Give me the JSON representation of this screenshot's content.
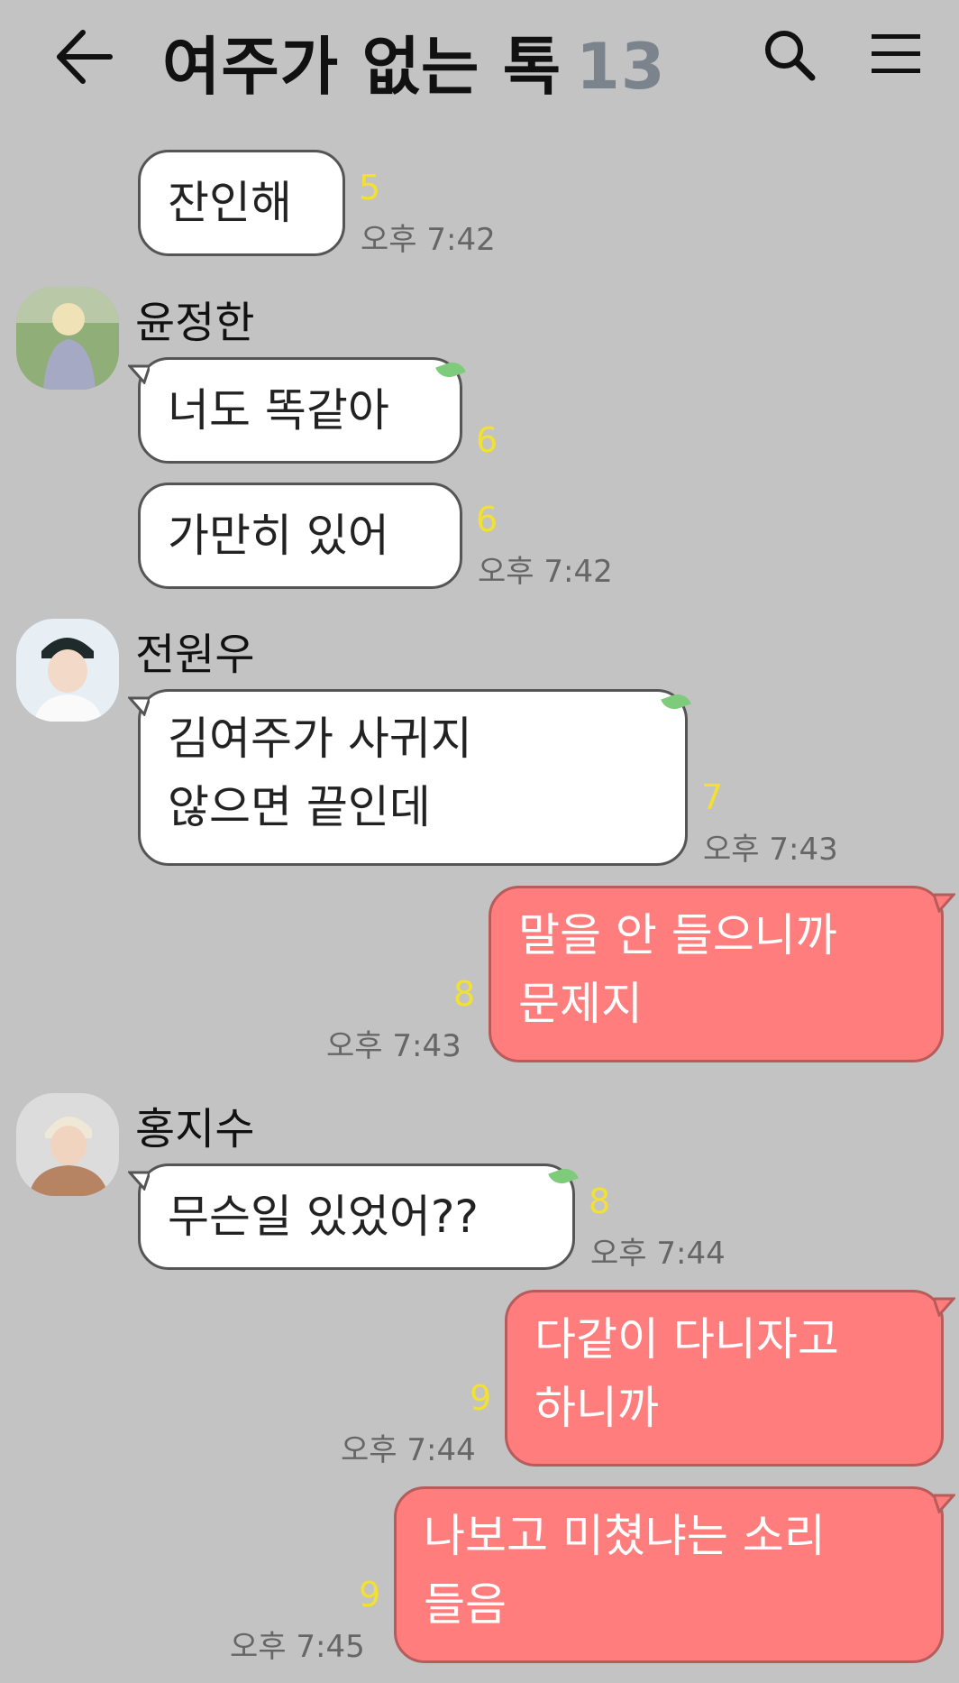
{
  "header": {
    "title": "여주가 없는 톡",
    "member_count": "13",
    "back_icon": "arrow-left-icon",
    "search_icon": "search-icon",
    "menu_icon": "hamburger-menu-icon"
  },
  "colors": {
    "background": "#c3c3c3",
    "my_bubble": "#ff7d7d",
    "other_bubble": "#ffffff",
    "unread": "#f2e131"
  },
  "messages": [
    {
      "sender": "",
      "text": "잔인해",
      "unread": "5",
      "time": "오후 7:42"
    },
    {
      "sender": "윤정한",
      "text": "너도 똑같아",
      "unread": "6",
      "time": ""
    },
    {
      "sender": "",
      "text": "가만히 있어",
      "unread": "6",
      "time": "오후 7:42"
    },
    {
      "sender": "전원우",
      "line1": "김여주가 사귀지",
      "line2": "않으면 끝인데",
      "unread": "7",
      "time": "오후 7:43"
    },
    {
      "sender": "me",
      "line1": "말을 안 들으니까",
      "line2": "문제지",
      "unread": "8",
      "time": "오후 7:43"
    },
    {
      "sender": "홍지수",
      "text": "무슨일 있었어??",
      "unread": "8",
      "time": "오후 7:44"
    },
    {
      "sender": "me",
      "line1": "다같이 다니자고",
      "line2": "하니까",
      "unread": "9",
      "time": "오후 7:44"
    },
    {
      "sender": "me",
      "line1": "나보고 미쳤냐는 소리",
      "line2": "들음",
      "unread": "9",
      "time": "오후 7:45"
    }
  ]
}
